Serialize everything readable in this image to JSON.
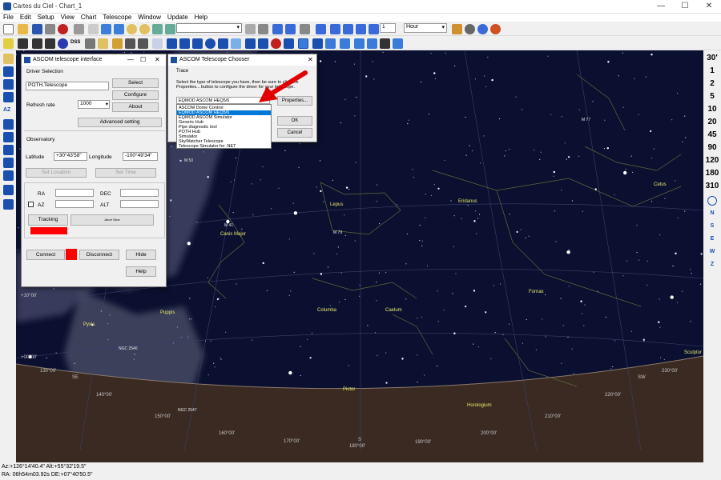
{
  "window": {
    "title": "Cartes du Ciel - Chart_1",
    "minimize": "—",
    "maximize": "☐",
    "close": "✕"
  },
  "menu": [
    "File",
    "Edit",
    "Setup",
    "View",
    "Chart",
    "Telescope",
    "Window",
    "Update",
    "Help"
  ],
  "toolbar": {
    "step_value": "1",
    "time_unit": "Hour",
    "dss_label": "DSS"
  },
  "fov_buttons": [
    "30'",
    "1",
    "2",
    "5",
    "10",
    "20",
    "45",
    "90",
    "120",
    "180",
    "310"
  ],
  "direction_buttons": [
    "N",
    "S",
    "E",
    "W",
    "Z"
  ],
  "status": {
    "line1": "Az:+126°14'40.4\" Alt:+55°32'19.5\"",
    "line2": "RA: 06h54m03.92s DE:+07°40'50.5\""
  },
  "telescope_interface": {
    "title": "ASCOM telescope interface",
    "driver_section": "Driver Selection",
    "driver_name": "POTH.Telescope",
    "select": "Select",
    "configure": "Configure",
    "about": "About",
    "refresh_rate_label": "Refresh rate",
    "refresh_rate_value": "1000",
    "advanced": "Advanced setting",
    "observatory": "Observatory",
    "latitude_label": "Latitude",
    "latitude_value": "+30°43'58\"",
    "longitude_label": "Longitude",
    "longitude_value": "-100°49'34\"",
    "set_location": "Set Location",
    "set_time": "Set Time",
    "ra_label": "RA",
    "dec_label": "DEC",
    "az_label": "AZ",
    "alt_label": "ALT",
    "tracking": "Tracking",
    "abort": "Abort Slew",
    "connect": "Connect",
    "disconnect": "Disconnect",
    "hide": "Hide",
    "help": "Help",
    "status_color": "#ff0000"
  },
  "chooser": {
    "title": "ASCOM Telescope Chooser",
    "trace_menu": "Trace",
    "instructions": "Select the type of telescope you have, then be sure to click the Properties... button to configure the driver for your telescope.",
    "selected": "EQMOD ASCOM HEQ5/6",
    "properties": "Properties...",
    "ok": "OK",
    "cancel": "Cancel",
    "options": [
      "ASCOM Dome Control",
      "EQMOD ASCOM HEQ5/6",
      "EQMOD ASCOM Simulator",
      "Generic Hub",
      "Pipe diagnostic tool",
      "POTH Hub",
      "Simulator",
      "SkyWatcher Telescope",
      "Telescope Simulator for .NET"
    ],
    "highlighted_index": 1
  },
  "sky": {
    "constellations": [
      "Lepus",
      "Canis Major",
      "Eridanus",
      "Cetus",
      "Columba",
      "Caelum",
      "Fornax",
      "Puppis",
      "Pyxis",
      "Pictor",
      "Horologium",
      "Sculptor"
    ],
    "objects": [
      "M 50",
      "M 41",
      "M 79",
      "NGC 2546",
      "NGC 2547",
      "M 77"
    ],
    "coords": [
      "+10°00'",
      "+00°00'",
      "130°00'",
      "140°00'",
      "150°00'",
      "160°00'",
      "170°00'",
      "180°00'",
      "190°00'",
      "200°00'",
      "210°00'",
      "220°00'",
      "230°00'"
    ],
    "horizon_labels": [
      "SE",
      "S",
      "SW"
    ],
    "colors": {
      "sky": "#0b1030",
      "ground": "#3a2a22",
      "milky_way": "#4a4e66",
      "constellation_label": "#e8e86a",
      "arrow": "#e00000"
    }
  }
}
